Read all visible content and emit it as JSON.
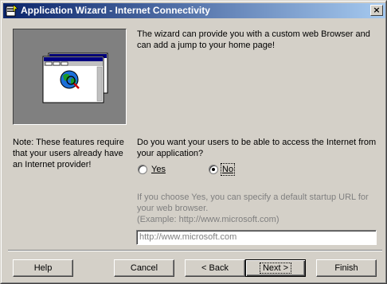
{
  "window": {
    "title": "Application Wizard - Internet Connectivity",
    "close_glyph": "×"
  },
  "intro": {
    "line1": "The wizard can provide you with a custom web Browser and",
    "line2": "can add a jump to your home page!"
  },
  "note": {
    "line1": "Note: These features require",
    "line2": "that your users already have",
    "line3": "an Internet provider!"
  },
  "question": {
    "line1": "Do you want your users to be able to access the Internet from",
    "line2": "your application?"
  },
  "options": {
    "yes_label": "Yes",
    "yes_selected": false,
    "no_label": "No",
    "no_selected": true
  },
  "url_help": {
    "line1": "If you choose Yes, you can specify a default startup URL for",
    "line2": "your web browser.",
    "line3": "(Example: http://www.microsoft.com)"
  },
  "url_field": {
    "value": "http://www.microsoft.com",
    "enabled": false
  },
  "buttons": {
    "help": "Help",
    "cancel": "Cancel",
    "back": "< Back",
    "next": "Next >",
    "finish": "Finish"
  },
  "icons": {
    "title": "wizard-app-icon",
    "illustration": "browser-globe-illustration"
  },
  "colors": {
    "title_start": "#0a246a",
    "title_end": "#a6caf0",
    "face": "#d4d0c8",
    "disabled_text": "#808080",
    "panel": "#808080"
  }
}
